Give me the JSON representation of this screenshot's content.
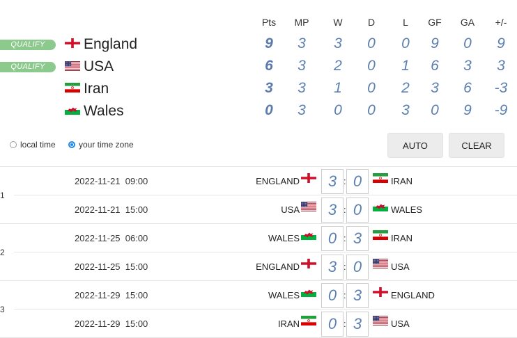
{
  "standings": {
    "headers": [
      "Pts",
      "MP",
      "W",
      "D",
      "L",
      "GF",
      "GA",
      "+/-"
    ],
    "qualify_label": "QUALIFY",
    "rows": [
      {
        "team": "England",
        "flag": "england",
        "qualify": true,
        "stats": [
          "9",
          "3",
          "3",
          "0",
          "0",
          "9",
          "0",
          "9"
        ]
      },
      {
        "team": "USA",
        "flag": "usa",
        "qualify": true,
        "stats": [
          "6",
          "3",
          "2",
          "0",
          "1",
          "6",
          "3",
          "3"
        ]
      },
      {
        "team": "Iran",
        "flag": "iran",
        "qualify": false,
        "stats": [
          "3",
          "3",
          "1",
          "0",
          "2",
          "3",
          "6",
          "-3"
        ]
      },
      {
        "team": "Wales",
        "flag": "wales",
        "qualify": false,
        "stats": [
          "0",
          "3",
          "0",
          "0",
          "3",
          "0",
          "9",
          "-9"
        ]
      }
    ]
  },
  "timezone": {
    "local_label": "local time",
    "yours_label": "your time zone",
    "selected": "yours"
  },
  "buttons": {
    "auto": "AUTO",
    "clear": "CLEAR"
  },
  "matchdays": [
    {
      "label": "1",
      "matches": [
        {
          "date": "2022-11-21  09:00",
          "home": "ENGLAND",
          "home_flag": "england",
          "home_score": "3",
          "away_score": "0",
          "away": "IRAN",
          "away_flag": "iran"
        },
        {
          "date": "2022-11-21  15:00",
          "home": "USA",
          "home_flag": "usa",
          "home_score": "3",
          "away_score": "0",
          "away": "WALES",
          "away_flag": "wales"
        }
      ]
    },
    {
      "label": "2",
      "matches": [
        {
          "date": "2022-11-25  06:00",
          "home": "WALES",
          "home_flag": "wales",
          "home_score": "0",
          "away_score": "3",
          "away": "IRAN",
          "away_flag": "iran"
        },
        {
          "date": "2022-11-25  15:00",
          "home": "ENGLAND",
          "home_flag": "england",
          "home_score": "3",
          "away_score": "0",
          "away": "USA",
          "away_flag": "usa"
        }
      ]
    },
    {
      "label": "3",
      "matches": [
        {
          "date": "2022-11-29  15:00",
          "home": "WALES",
          "home_flag": "wales",
          "home_score": "0",
          "away_score": "3",
          "away": "ENGLAND",
          "away_flag": "england"
        },
        {
          "date": "2022-11-29  15:00",
          "home": "IRAN",
          "home_flag": "iran",
          "home_score": "0",
          "away_score": "3",
          "away": "USA",
          "away_flag": "usa"
        }
      ]
    }
  ]
}
